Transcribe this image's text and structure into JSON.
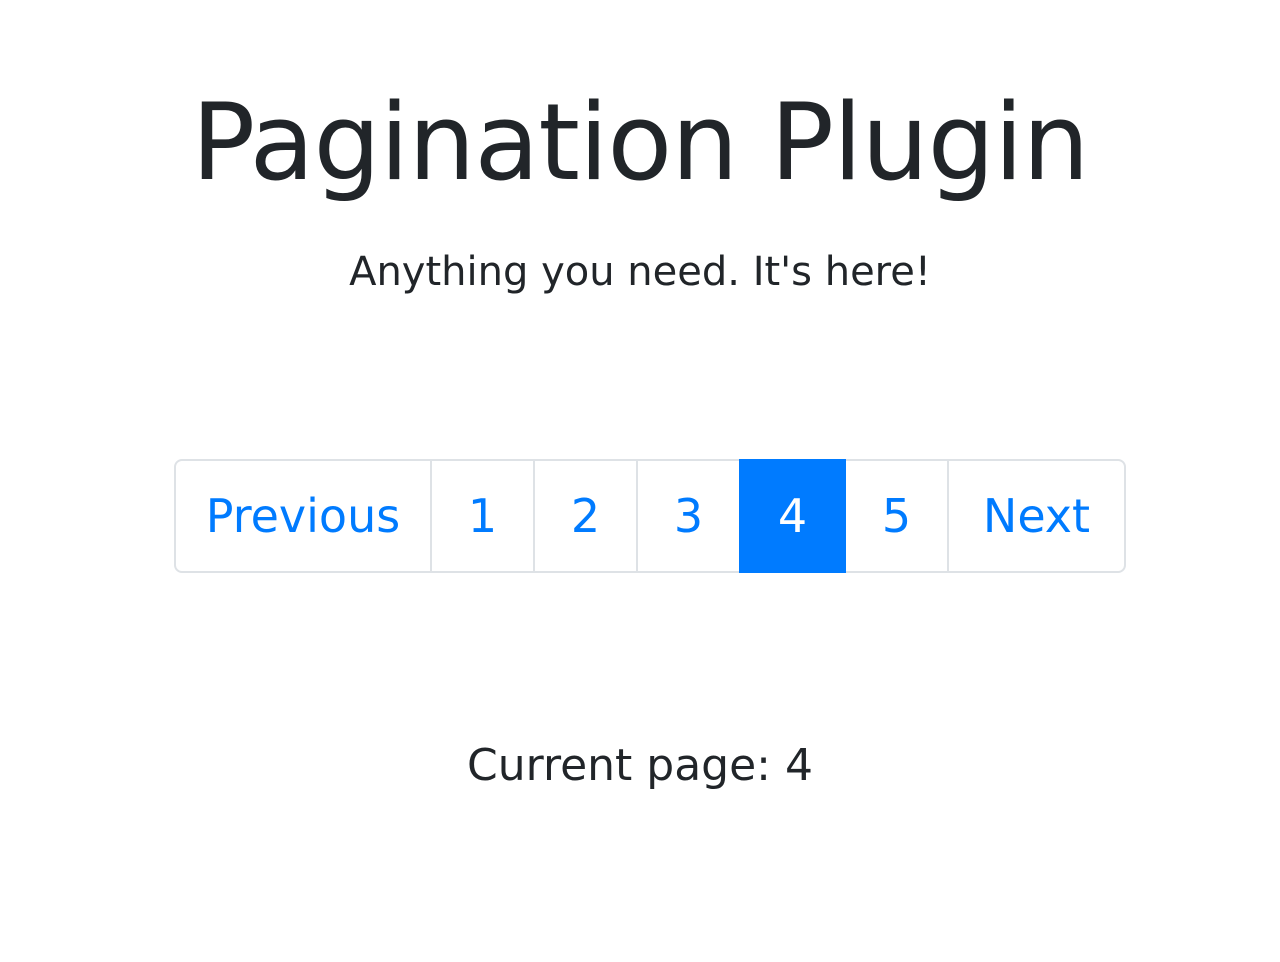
{
  "header": {
    "title": "Pagination Plugin",
    "subtitle": "Anything you need. It's here!"
  },
  "pagination": {
    "previous_label": "Previous",
    "next_label": "Next",
    "pages": [
      "1",
      "2",
      "3",
      "4",
      "5"
    ],
    "active_page": "4"
  },
  "status": {
    "current_page_text": "Current page: 4"
  },
  "colors": {
    "accent": "#007bff",
    "text": "#212529",
    "border": "#dee2e6",
    "background": "#ffffff"
  }
}
